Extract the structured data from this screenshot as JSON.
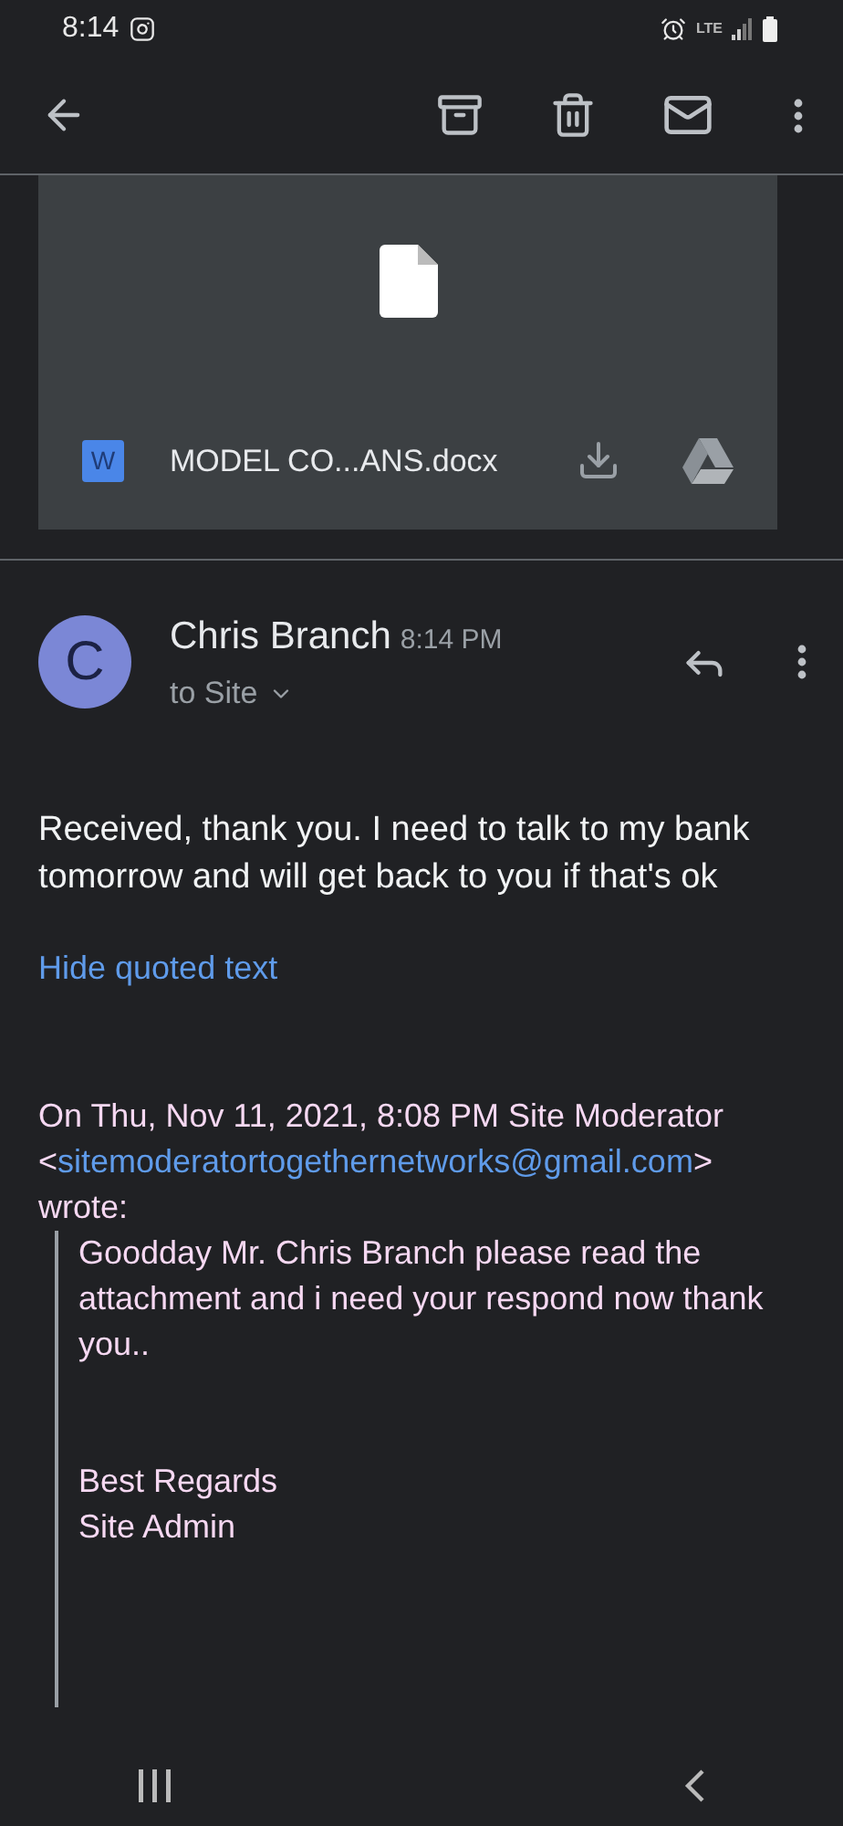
{
  "status_bar": {
    "time": "8:14",
    "network": "LTE"
  },
  "attachment": {
    "filename": "MODEL CO...ANS.docx",
    "type_badge": "W"
  },
  "message": {
    "sender": "Chris Branch",
    "time": "8:14 PM",
    "recipient": "to Site",
    "initial": "C",
    "body": "Received, thank you. I need to talk to my bank tomorrow and will get back to you if that's ok",
    "hide_quoted": "Hide quoted text",
    "quote_header": {
      "prefix": "On Thu, Nov 11, 2021, 8:08 PM Site Moderator <",
      "email": "sitemoderatortogethernetworks@gmail.com",
      "suffix": "> wrote:"
    },
    "quote_lines": [
      "Goodday Mr. Chris Branch please read the attachment and i need your respond now thank you..",
      "Best Regards",
      "Site Admin"
    ]
  }
}
